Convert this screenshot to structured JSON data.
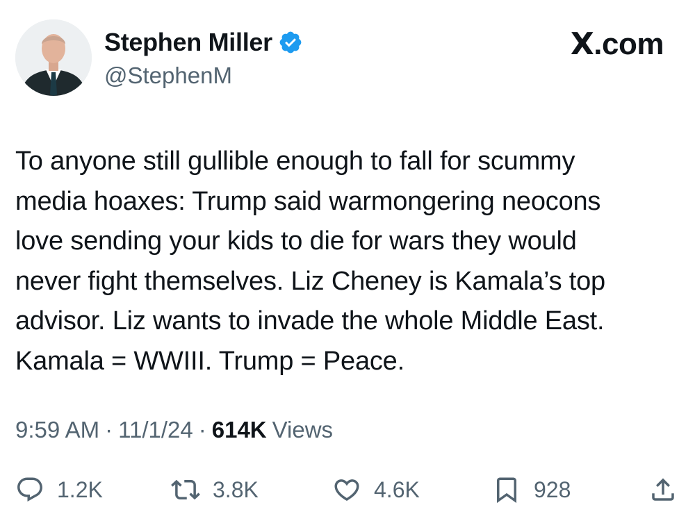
{
  "author": {
    "display_name": "Stephen Miller",
    "handle": "@StephenM",
    "verified": true,
    "verified_color": "#1d9bf0"
  },
  "brand": {
    "logo": "X",
    "suffix": ".com"
  },
  "tweet": {
    "text": "To anyone still gullible enough to fall for scummy\nmedia hoaxes: Trump said warmongering neocons\nlove sending your kids to die for wars they would\nnever fight themselves. Liz Cheney is Kamala’s top\nadvisor. Liz wants to invade the whole Middle East.\nKamala = WWIII. Trump = Peace."
  },
  "meta": {
    "time": "9:59 AM",
    "separator": "·",
    "date": "11/1/24",
    "views_count": "614K",
    "views_label": "Views"
  },
  "actions": {
    "replies": "1.2K",
    "reposts": "3.8K",
    "likes": "4.6K",
    "bookmarks": "928"
  },
  "icons": {
    "reply": "reply-icon",
    "repost": "repost-icon",
    "like": "heart-icon",
    "bookmark": "bookmark-icon",
    "share": "share-icon"
  }
}
